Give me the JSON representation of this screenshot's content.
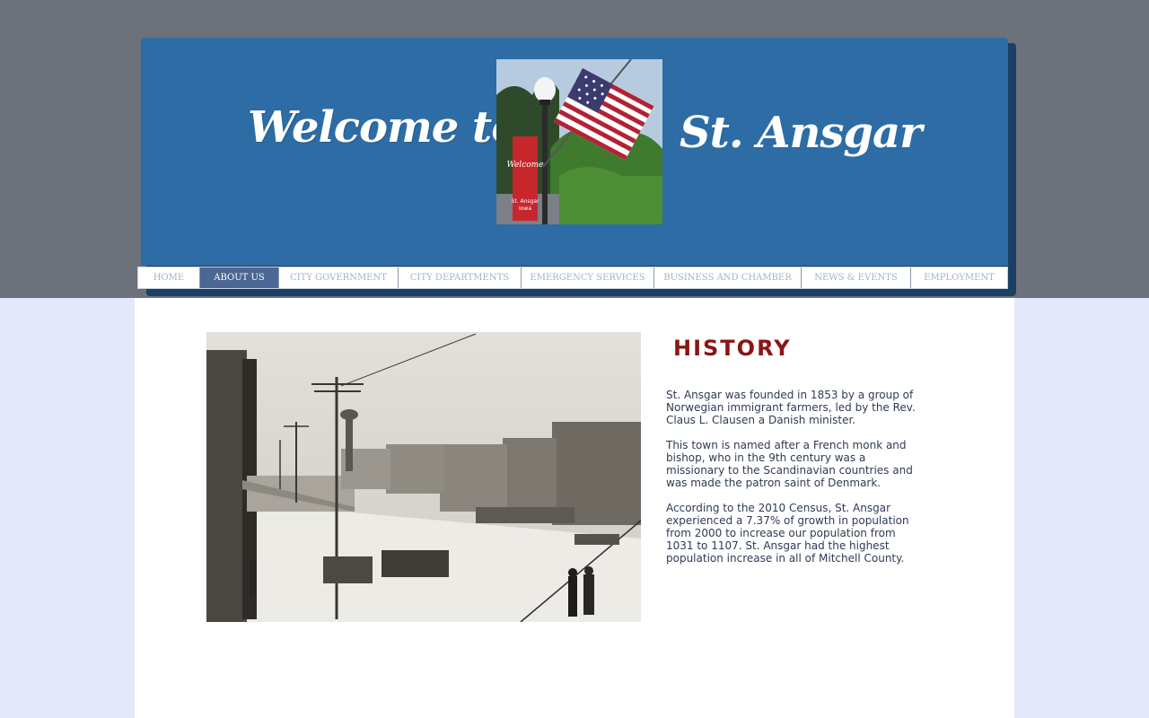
{
  "header": {
    "welcome_text": "Welcome to",
    "town_text": "St. Ansgar",
    "banner_text_top": "Welcome",
    "banner_text_bottom": "St. Ansgar Iowa"
  },
  "nav": {
    "items": [
      {
        "label": "HOME",
        "active": false
      },
      {
        "label": "ABOUT US",
        "active": true
      },
      {
        "label": "CITY GOVERNMENT",
        "active": false
      },
      {
        "label": "CITY DEPARTMENTS",
        "active": false
      },
      {
        "label": "EMERGENCY SERVICES",
        "active": false
      },
      {
        "label": "BUSINESS AND CHAMBER",
        "active": false
      },
      {
        "label": "NEWS & EVENTS",
        "active": false
      },
      {
        "label": "EMPLOYMENT",
        "active": false
      }
    ]
  },
  "history": {
    "title": "HISTORY",
    "paragraphs": [
      "St. Ansgar was founded in 1853 by a group of\nNorwegian immigrant farmers, led by the Rev.\nClaus L. Clausen a Danish minister.",
      "This town is named after a French monk and\nbishop, who in the 9th century was a\nmissionary to the Scandinavian countries and\nwas made the patron saint of Denmark.",
      "According to the 2010 Census, St. Ansgar\nexperienced a 7.37% of growth in population\nfrom 2000 to increase our population from\n1031 to 1107.  St. Ansgar had the highest\npopulation increase in all of Mitchell County."
    ]
  },
  "colors": {
    "header_blue": "#2d6ca5",
    "active_nav": "#4b6793",
    "title_red": "#8a1515",
    "top_band": "#6c717b",
    "page_background": "#e4e8fb"
  }
}
